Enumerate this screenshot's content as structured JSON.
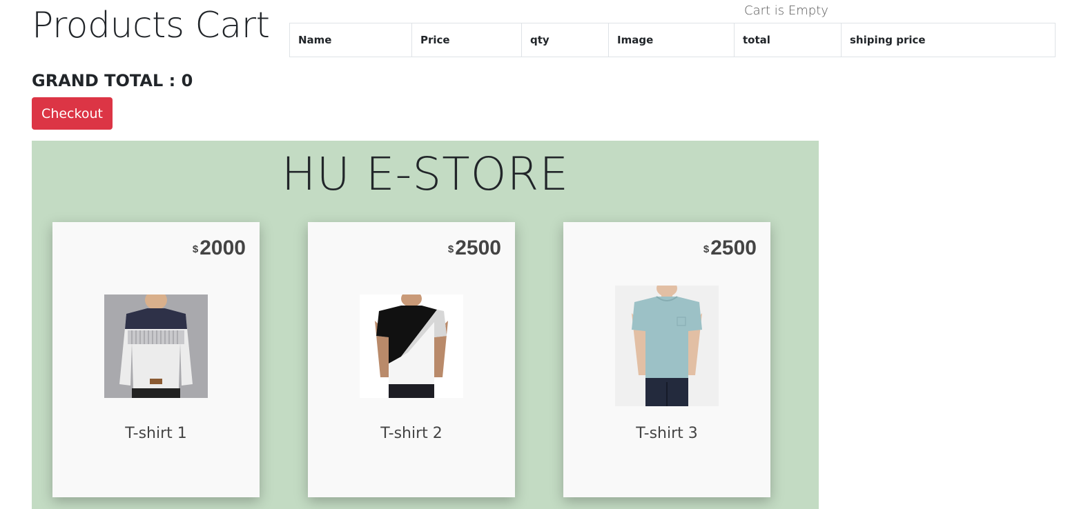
{
  "header": {
    "title": "Products Cart",
    "cart_status": "Cart is Empty"
  },
  "cart_table": {
    "columns": [
      "Name",
      "Price",
      "qty",
      "Image",
      "total",
      "shiping price"
    ]
  },
  "summary": {
    "grand_total_label": "GRAND TOTAL : 0",
    "checkout_label": "Checkout"
  },
  "store": {
    "title": "HU E-STORE",
    "products": [
      {
        "name": "T-shirt 1",
        "currency": "$",
        "price": "2000",
        "shirt_color": "#ececec",
        "accent_color": "#2e3148"
      },
      {
        "name": "T-shirt 2",
        "currency": "$",
        "price": "2500",
        "shirt_color": "#f5f5f5",
        "accent_color": "#111111"
      },
      {
        "name": "T-shirt 3",
        "currency": "$",
        "price": "2500",
        "shirt_color": "#9cc1c6",
        "accent_color": "#9cc1c6"
      }
    ]
  },
  "colors": {
    "checkout": "#dc3545",
    "store_background": "#c3dbc3"
  }
}
